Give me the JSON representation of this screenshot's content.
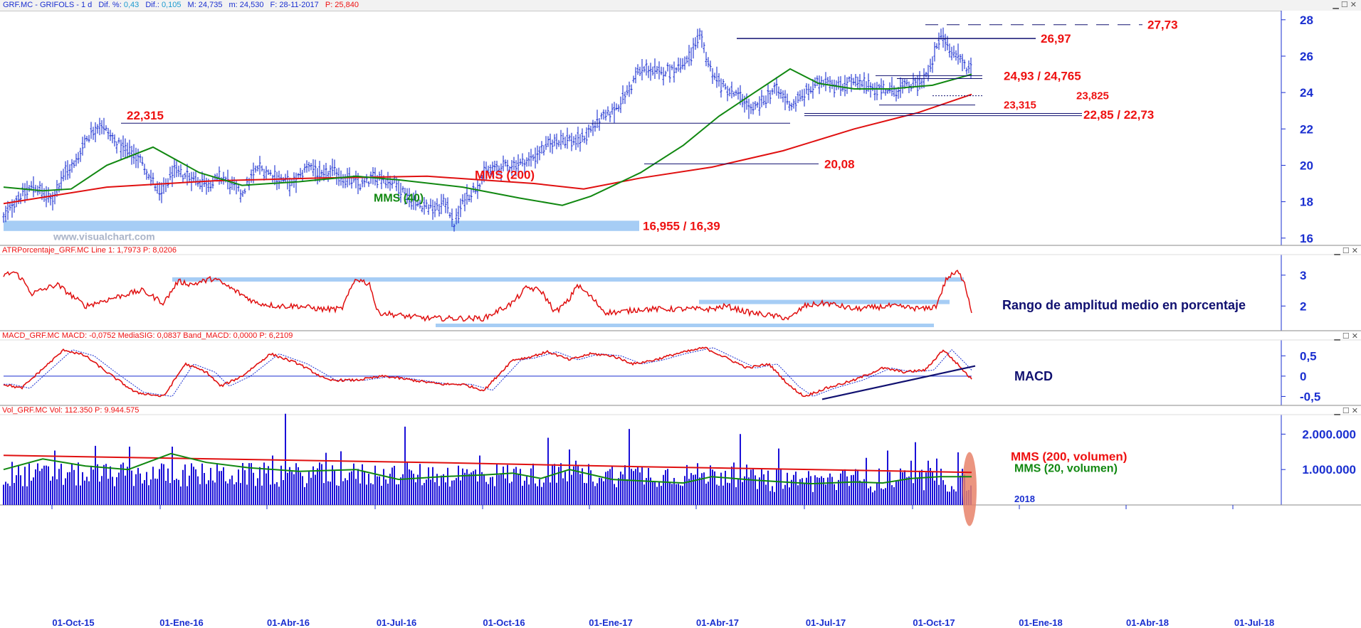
{
  "header": {
    "symbol": "GRF.MC - GRIFOLS - 1 d",
    "dif_pct_label": "Dif. %:",
    "dif_pct": "0,43",
    "dif_label": "Dif.:",
    "dif": "0,105",
    "max": "M: 24,735",
    "min": "m: 24,530",
    "date": "F: 28-11-2017",
    "price": "P: 25,840"
  },
  "watermark": "www.visualchart.com",
  "price_panel": {
    "ylim": [
      15.6,
      28.5
    ],
    "yticks": [
      "16",
      "18",
      "20",
      "22",
      "24",
      "26",
      "28"
    ],
    "annotations": [
      "22,315",
      "MMS (200)",
      "MMS (40)",
      "20,08",
      "16,955 / 16,39",
      "26,97",
      "27,73",
      "24,93 / 24,765",
      "23,825",
      "23,315",
      "22,85 / 22,73"
    ]
  },
  "atr_panel": {
    "title": "ATRPorcentaje_GRF.MC  Line 1: 1,7973  P: 8,0206",
    "ylim": [
      1.2,
      3.55
    ],
    "yticks": [
      "2",
      "3"
    ],
    "caption": "Rango de amplitud medio en porcentaje"
  },
  "macd_panel": {
    "title": "MACD_GRF.MC  MACD: -0,0752  MediaSIG: 0,0837  Band_MACD: 0,0000  P: 6,2109",
    "ylim": [
      -0.72,
      0.82
    ],
    "yticks": [
      "0,5",
      "0",
      "-0,5"
    ],
    "caption": "MACD"
  },
  "vol_panel": {
    "title": "Vol_GRF.MC  Vol: 112.350  P: 9.944.575",
    "ylim": [
      0,
      2450000
    ],
    "yticks": [
      "2.000.000",
      "1.000.000"
    ],
    "caption_200": "MMS (200, volumen)",
    "caption_20": "MMS (20, volumen)",
    "year_marker": "2018"
  },
  "xaxis": {
    "ticks": [
      "01-Oct-15",
      "01-Ene-16",
      "01-Abr-16",
      "01-Jul-16",
      "01-Oct-16",
      "01-Ene-17",
      "01-Abr-17",
      "01-Jul-17",
      "01-Oct-17",
      "01-Ene-18",
      "01-Abr-18",
      "01-Jul-18"
    ]
  },
  "colors": {
    "price_bars": "#1a2fd0",
    "mms200": "#e01010",
    "mms40": "#118811",
    "level_line": "#101070",
    "zone": "#a6cdf5",
    "atr_line": "#e01010",
    "macd_line": "#e01010",
    "signal_line": "#1a2fd0",
    "trend_line": "#101070",
    "volume_bars": "#1a10d8",
    "vol_highlight": "#e8826a"
  },
  "chart_data": [
    {
      "type": "line",
      "title": "",
      "series": [
        {
          "name": "MMS (200)",
          "x": [
            "01-Oct-15",
            "01-Ene-16",
            "01-Abr-16",
            "01-Jul-16",
            "01-Oct-16",
            "01-Ene-17",
            "01-Abr-17",
            "01-Jul-17",
            "01-Oct-17",
            "28-11-2017"
          ],
          "values": [
            17.9,
            19.1,
            19.3,
            19.4,
            19.2,
            18.8,
            19.8,
            21.2,
            22.8,
            23.9
          ]
        },
        {
          "name": "MMS (40)",
          "x": [
            "01-Oct-15",
            "01-Nov-15",
            "01-Ene-16",
            "01-Abr-16",
            "01-Jul-16",
            "01-Oct-16",
            "01-Dic-16",
            "01-Ene-17",
            "01-Abr-17",
            "01-Jun-17",
            "01-Jul-17",
            "01-Oct-17",
            "28-11-2017"
          ],
          "values": [
            18.6,
            20.4,
            19.2,
            18.9,
            19.4,
            18.4,
            17.7,
            18.3,
            22.8,
            25.3,
            24.4,
            24.4,
            25.0
          ]
        }
      ],
      "levels": [
        22.315,
        20.08,
        16.955,
        16.39,
        26.97,
        27.73,
        24.93,
        24.765,
        23.825,
        23.315,
        22.85,
        22.73
      ],
      "ylim": [
        15.6,
        28.5
      ]
    },
    {
      "type": "line",
      "title": "ATRPorcentaje_GRF.MC",
      "series": [
        {
          "name": "ATRPorcentaje_GRF.MC",
          "values": [
            3.0,
            3.1,
            2.8,
            2.4,
            2.2,
            2.3,
            2.8,
            2.9,
            2.5,
            2.2,
            2.0,
            2.9,
            1.7,
            1.8,
            2.9,
            1.8,
            1.6,
            1.6,
            2.1,
            2.2,
            1.9,
            2.0,
            1.8,
            2.3,
            3.1,
            2.4,
            1.8
          ]
        }
      ],
      "ylim": [
        1.2,
        3.55
      ]
    },
    {
      "type": "line",
      "title": "MACD_GRF.MC",
      "series": [
        {
          "name": "MACD",
          "values": [
            -0.3,
            0.1,
            0.65,
            0.3,
            -0.2,
            -0.5,
            0.3,
            0.1,
            -0.2,
            0.5,
            -0.3,
            0.0,
            -0.2,
            0.2,
            0.4,
            0.6,
            0.7,
            0.2,
            -0.5,
            0.2,
            0.0,
            0.6,
            -0.08
          ]
        },
        {
          "name": "MediaSIG",
          "values": [
            -0.25,
            0.05,
            0.55,
            0.35,
            -0.1,
            -0.45,
            0.25,
            0.1,
            -0.15,
            0.45,
            -0.25,
            0.0,
            -0.15,
            0.15,
            0.35,
            0.55,
            0.65,
            0.25,
            -0.4,
            0.15,
            0.05,
            0.5,
            0.08
          ]
        }
      ],
      "ylim": [
        -0.72,
        0.82
      ]
    },
    {
      "type": "bar",
      "title": "Vol_GRF.MC",
      "series": [
        {
          "name": "MMS (200, volumen)",
          "values": [
            1400000,
            1250000,
            1050000,
            900000,
            800000
          ]
        },
        {
          "name": "MMS (20, volumen)",
          "values": [
            1000000,
            1450000,
            1000000,
            650000,
            900000,
            620000,
            800000,
            700000
          ]
        }
      ],
      "ylim": [
        0,
        2450000
      ]
    }
  ]
}
